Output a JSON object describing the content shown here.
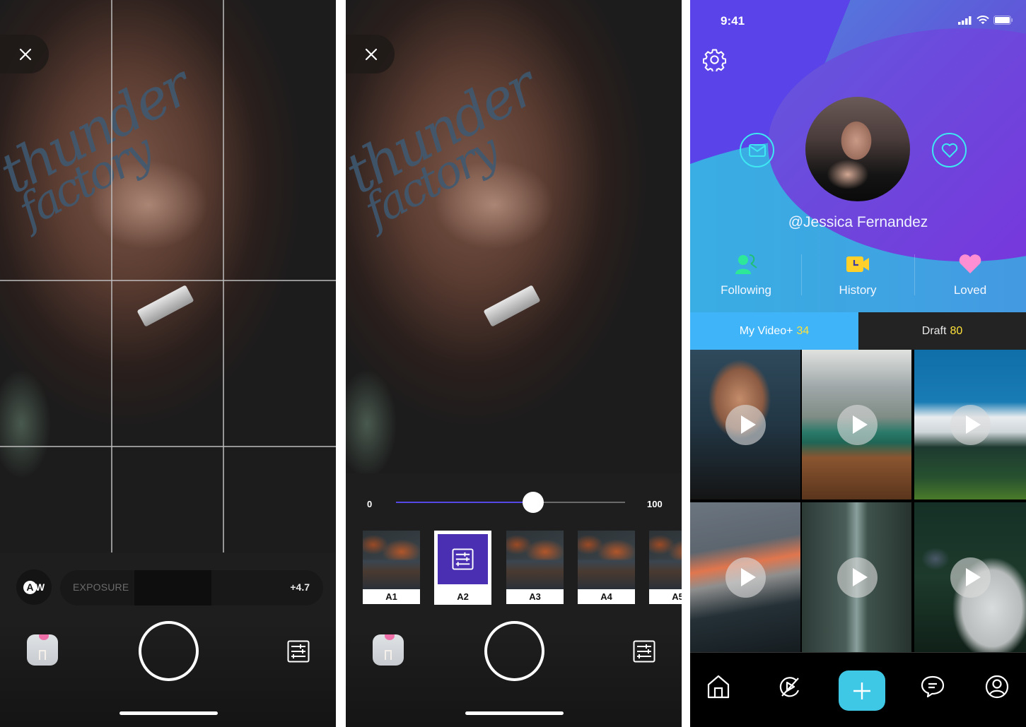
{
  "camera_screen": {
    "close_icon": "close-icon",
    "white_balance_label": "A",
    "white_balance_suffix": "W",
    "exposure_label": "EXPOSURE",
    "exposure_value": "+4.7",
    "gallery_icon": "gallery-thumbnail",
    "shutter_icon": "shutter-button",
    "adjust_icon": "sliders-icon"
  },
  "filter_screen": {
    "close_icon": "close-icon",
    "slider": {
      "min_label": "0",
      "max_label": "100",
      "value_percent": 60
    },
    "filters": [
      {
        "label": "A1",
        "selected": false
      },
      {
        "label": "A2",
        "selected": true
      },
      {
        "label": "A3",
        "selected": false
      },
      {
        "label": "A4",
        "selected": false
      },
      {
        "label": "A5",
        "selected": false
      }
    ],
    "accent_color": "#5548e6"
  },
  "profile_screen": {
    "status_bar": {
      "time": "9:41"
    },
    "username": "@Jessica Fernandez",
    "stats": [
      {
        "label": "Following",
        "icon": "following-user-icon"
      },
      {
        "label": "History",
        "icon": "video-history-icon"
      },
      {
        "label": "Loved",
        "icon": "heart-icon"
      }
    ],
    "tabs": [
      {
        "label": "My Video+",
        "count": "34",
        "active": true
      },
      {
        "label": "Draft",
        "count": "80",
        "active": false
      }
    ],
    "videos": [
      {
        "subject": "portrait-woman"
      },
      {
        "subject": "mountain-lake-boat"
      },
      {
        "subject": "clouds-mountain-valley"
      },
      {
        "subject": "sunset-peak-forest"
      },
      {
        "subject": "waterfall-forest"
      },
      {
        "subject": "bird-on-hand"
      }
    ],
    "nav": [
      {
        "name": "home",
        "icon": "home-icon"
      },
      {
        "name": "discover",
        "icon": "discover-play-icon"
      },
      {
        "name": "add",
        "icon": "plus-icon"
      },
      {
        "name": "messages",
        "icon": "chat-icon"
      },
      {
        "name": "profile",
        "icon": "profile-icon"
      }
    ],
    "colors": {
      "active_tab": "#40b4f8",
      "count_highlight": "#ffe23a",
      "add_button": "#3fc8e6"
    }
  }
}
